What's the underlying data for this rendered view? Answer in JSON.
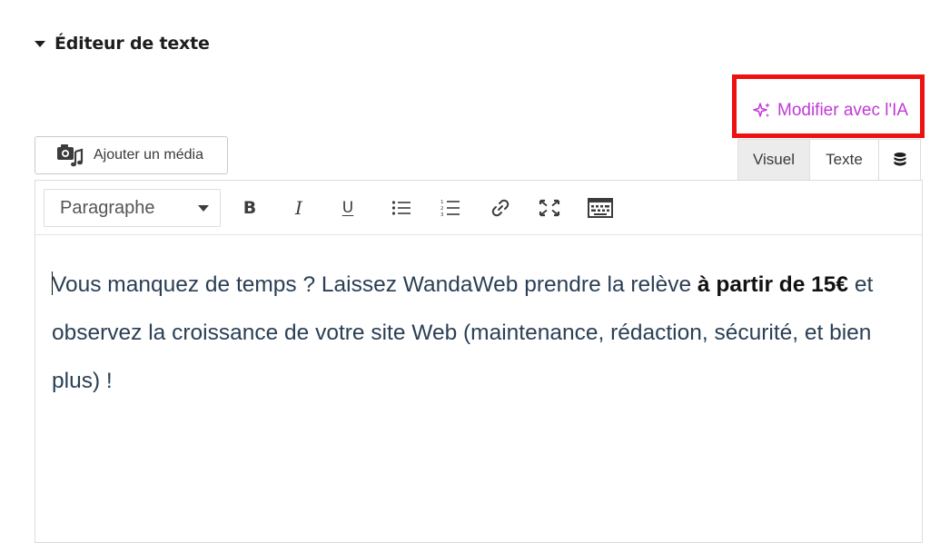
{
  "section": {
    "title": "Éditeur de texte"
  },
  "ai": {
    "label": "Modifier avec l'IA"
  },
  "media": {
    "label": "Ajouter un média"
  },
  "modes": {
    "visual": "Visuel",
    "text": "Texte"
  },
  "toolbar": {
    "format_value": "Paragraphe",
    "bold": "B",
    "italic": "I",
    "underline": "U"
  },
  "content": {
    "part1": "Vous manquez de temps ? Laissez WandaWeb prendre la relève ",
    "bold": "à partir de 15€",
    "part2": " et observez la croissance de votre site Web (maintenance, rédaction, sécurité, et bien plus) !"
  },
  "colors": {
    "ai_accent": "#c139d6",
    "highlight_box": "#ee1111",
    "body_text": "#2a3f55"
  },
  "icons": [
    "caret-down-icon",
    "sparkle-icon",
    "media-icon",
    "database-icon",
    "bullet-list-icon",
    "numbered-list-icon",
    "link-icon",
    "fullscreen-icon",
    "keyboard-icon"
  ]
}
